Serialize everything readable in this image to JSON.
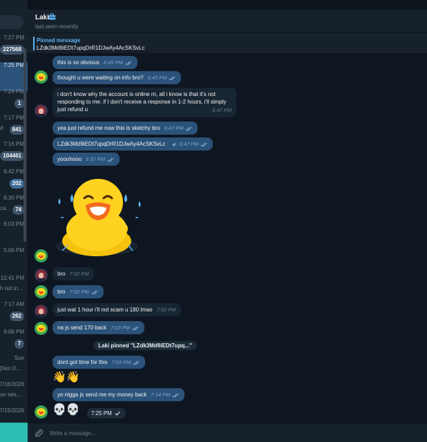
{
  "sidebar": {
    "rows": [
      {
        "time": "7:27 PM",
        "badge": "227568",
        "snippet": "",
        "active": false,
        "blue": false
      },
      {
        "time": "7:25 PM",
        "badge": "",
        "snippet": "",
        "active": true,
        "blue": false
      },
      {
        "time": "7:24 PM",
        "badge": "1",
        "snippet": "",
        "active": false,
        "blue": false
      },
      {
        "time": "7:17 PM",
        "badge": "841",
        "snippet": "d",
        "active": false,
        "blue": false
      },
      {
        "time": "7:16 PM",
        "badge": "104461",
        "snippet": "",
        "active": false,
        "blue": false
      },
      {
        "time": "6:42 PM",
        "badge": "202",
        "snippet": "",
        "active": false,
        "blue": true
      },
      {
        "time": "6:30 PM",
        "badge": "74",
        "snippet": "ca...",
        "active": false,
        "blue": false
      },
      {
        "time": "6:03 PM",
        "badge": "",
        "snippet": "",
        "active": false,
        "blue": false
      },
      {
        "time": "5:06 PM",
        "badge": "",
        "snippet": "",
        "active": false,
        "blue": false
      },
      {
        "time": "12:41 PM",
        "badge": "",
        "snippet": "h out in...",
        "active": false,
        "blue": false
      },
      {
        "time": "7:17 AM",
        "badge": "262",
        "snippet": "",
        "active": false,
        "blue": false
      },
      {
        "time": "9:06 PM",
        "badge": "7",
        "snippet": "",
        "active": false,
        "blue": false
      },
      {
        "time": "Sun",
        "badge": "",
        "snippet": "[Not O...",
        "active": false,
        "blue": false
      },
      {
        "time": "7/16/2026",
        "badge": "",
        "snippet": "on tele...",
        "active": false,
        "blue": false
      },
      {
        "time": "7/15/2026",
        "badge": "",
        "snippet": "",
        "active": false,
        "blue": false
      }
    ]
  },
  "header": {
    "name": "Laki",
    "status": "last seen recently",
    "lock_icon": "briefcase-icon"
  },
  "pinned": {
    "title": "Pinned message",
    "text": "LZdk3Md9iEDt7upqDrR1DJwAy4AcSKSvLc"
  },
  "messages": [
    {
      "id": "m1",
      "dir": "out",
      "text": "this is so obvious",
      "time": "6:45 PM",
      "read": true
    },
    {
      "id": "m2",
      "dir": "out",
      "text": "thought u were waiting on info bro?",
      "time": "6:45 PM",
      "read": true
    },
    {
      "id": "m3",
      "dir": "in",
      "text": "i don't know why the account is online rn, all i know is that it's not responding to me. if I don't receive a response in 1-2 hours, i'll simply just refund u",
      "time": "6:47 PM"
    },
    {
      "id": "m4",
      "dir": "out",
      "text": "yea just refund me now this is sketchy bro",
      "time": "6:47 PM",
      "read": true
    },
    {
      "id": "m5",
      "dir": "out",
      "text": "LZdk3Md9iEDt7upqDrR1DJwAy4AcSKSvLc",
      "time": "6:47 PM",
      "read": true,
      "pinned": true
    },
    {
      "id": "m6",
      "dir": "out",
      "text": "yooohooo",
      "time": "6:57 PM",
      "read": true
    },
    {
      "id": "m7",
      "dir": "in",
      "text": "bro",
      "time": "7:02 PM"
    },
    {
      "id": "m8",
      "dir": "out",
      "text": "bro",
      "time": "7:02 PM",
      "read": true
    },
    {
      "id": "m9",
      "dir": "in",
      "text": "just wat 1 hour i'll not scam u 180 lmao",
      "time": "7:02 PM"
    },
    {
      "id": "m10",
      "dir": "out",
      "text": "na js send 170 back",
      "time": "7:03 PM",
      "read": true
    },
    {
      "id": "m11",
      "dir": "out",
      "text": "dont got time for this",
      "time": "7:03 PM",
      "read": true
    },
    {
      "id": "m12",
      "dir": "out",
      "text": "👋👋",
      "time": "",
      "read": true
    },
    {
      "id": "m13",
      "dir": "out",
      "text": "yo nigga js send me my money back",
      "time": "7:14 PM",
      "read": true
    },
    {
      "id": "m14",
      "dir": "out",
      "text": "💀💀",
      "time": "7:25 PM",
      "read": false
    }
  ],
  "service_message": "Laki pinned \"LZdk3Md9iEDt7upq...\"",
  "sticker": {
    "name": "laughing-duck-sticker"
  },
  "input": {
    "placeholder": "Write a message..."
  },
  "colors": {
    "outgoing": "#2b5278",
    "incoming": "#182533",
    "accent": "#5eb5f7",
    "background": "#0e1621"
  }
}
